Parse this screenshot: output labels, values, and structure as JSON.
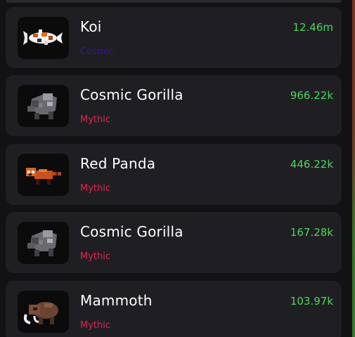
{
  "colors": {
    "value_green": "#4ed45a",
    "mythic_red": "#e0264f",
    "cosmic_purple": "#3a0fa8",
    "card_bg": "#1f1f23"
  },
  "pets": [
    {
      "name": "Koi",
      "rarity": "Cosmic",
      "value": "12.46m",
      "icon": "koi-fish-icon"
    },
    {
      "name": "Cosmic Gorilla",
      "rarity": "Mythic",
      "value": "966.22k",
      "icon": "gorilla-icon"
    },
    {
      "name": "Red Panda",
      "rarity": "Mythic",
      "value": "446.22k",
      "icon": "red-panda-icon"
    },
    {
      "name": "Cosmic Gorilla",
      "rarity": "Mythic",
      "value": "167.28k",
      "icon": "gorilla-icon"
    },
    {
      "name": "Mammoth",
      "rarity": "Mythic",
      "value": "103.97k",
      "icon": "mammoth-icon"
    }
  ]
}
